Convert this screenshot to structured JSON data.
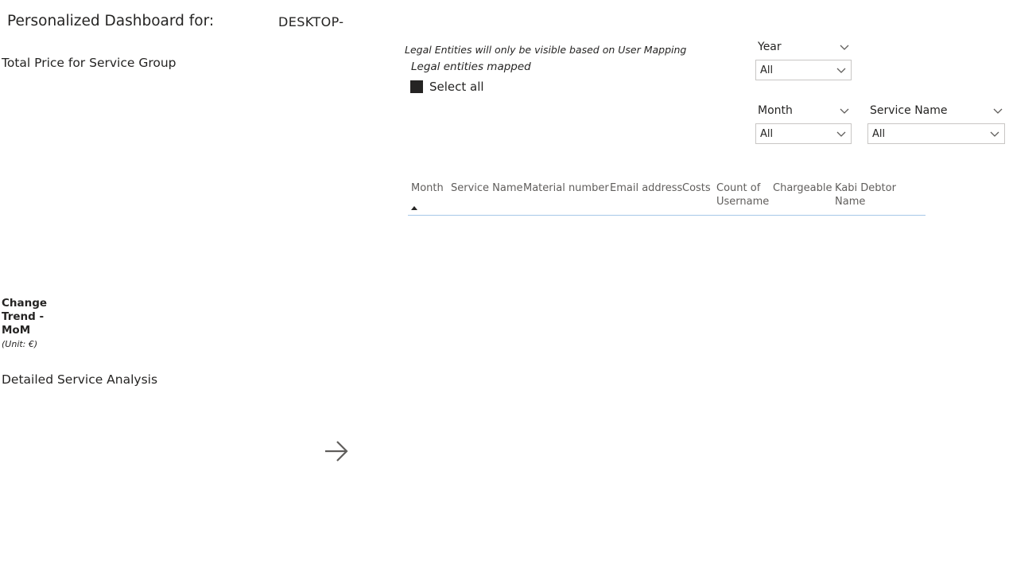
{
  "header": {
    "title": "Personalized Dashboard for:",
    "user": "DESKTOP-"
  },
  "sections": {
    "total_price": "Total Price for Service Group",
    "detailed": "Detailed Service Analysis"
  },
  "legal": {
    "note": "Legal Entities will only be visible based on User Mapping",
    "mapped_title": "Legal entities mapped",
    "select_all": "Select all"
  },
  "slicers": {
    "year": {
      "label": "Year",
      "value": "All"
    },
    "month": {
      "label": "Month",
      "value": "All"
    },
    "service_name": {
      "label": "Service Name",
      "value": "All"
    }
  },
  "table": {
    "columns": [
      "Month",
      "Service Name",
      "Material number",
      "Email address",
      "Costs",
      "Count of Username",
      "Chargeable",
      "Kabi Debtor Name"
    ]
  },
  "trend": {
    "title": "Change Trend - MoM",
    "unit": "(Unit: €)"
  },
  "icons": {
    "chevron": "chevron-down-icon",
    "arrow": "arrow-right-icon",
    "sort": "sort-ascending-icon"
  }
}
